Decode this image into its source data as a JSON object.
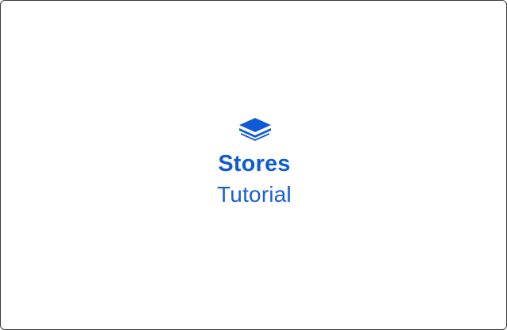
{
  "brand": {
    "icon": "stacked-layers-icon",
    "title": "Stores",
    "subtitle": "Tutorial",
    "accent_color": "#0f5bd6"
  }
}
